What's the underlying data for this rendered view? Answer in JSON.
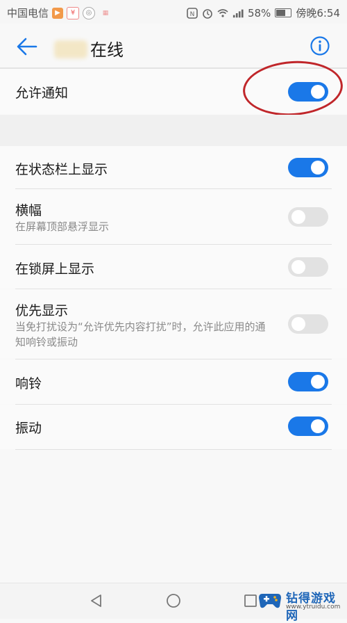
{
  "status_bar": {
    "carrier": "中国电信",
    "battery": "58%",
    "time": "傍晚6:54"
  },
  "header": {
    "title_suffix": "在线"
  },
  "main_toggle": {
    "label": "允许通知",
    "on": true
  },
  "settings": [
    {
      "label": "在状态栏上显示",
      "sub": "",
      "on": true
    },
    {
      "label": "横幅",
      "sub": "在屏幕顶部悬浮显示",
      "on": false
    },
    {
      "label": "在锁屏上显示",
      "sub": "",
      "on": false
    },
    {
      "label": "优先显示",
      "sub": "当免打扰设为“允许优先内容打扰”时，允许此应用的通知响铃或振动",
      "on": false
    },
    {
      "label": "响铃",
      "sub": "",
      "on": true
    },
    {
      "label": "振动",
      "sub": "",
      "on": true
    }
  ],
  "watermark": {
    "name": "钻得游戏网",
    "url": "www.ytruidu.com"
  },
  "colors": {
    "accent": "#1a78e8",
    "annotation": "#c0262a"
  }
}
